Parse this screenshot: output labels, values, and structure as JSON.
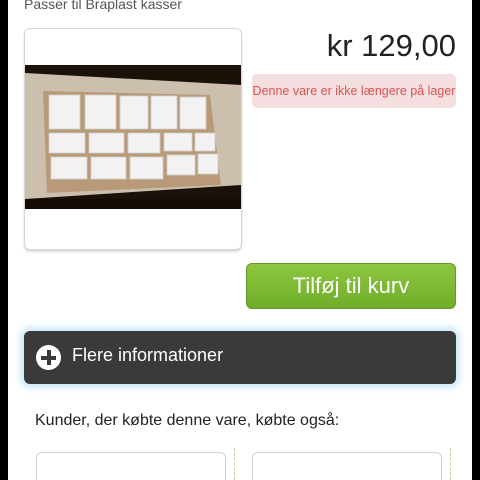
{
  "product": {
    "subtitle": "Passer til Braplast kasser",
    "price": "kr 129,00",
    "stock_notice": "Denne vare er ikke længere på lager",
    "add_to_cart": "Tilføj til kurv",
    "more_info": "Flere informationer"
  },
  "related": {
    "title": "Kunder, der købte denne vare, købte også:"
  },
  "colors": {
    "button_green": "#7dba33",
    "info_bar": "#3a3a3a",
    "stock_text": "#d9534f",
    "stock_bg": "#f6dfe0"
  }
}
